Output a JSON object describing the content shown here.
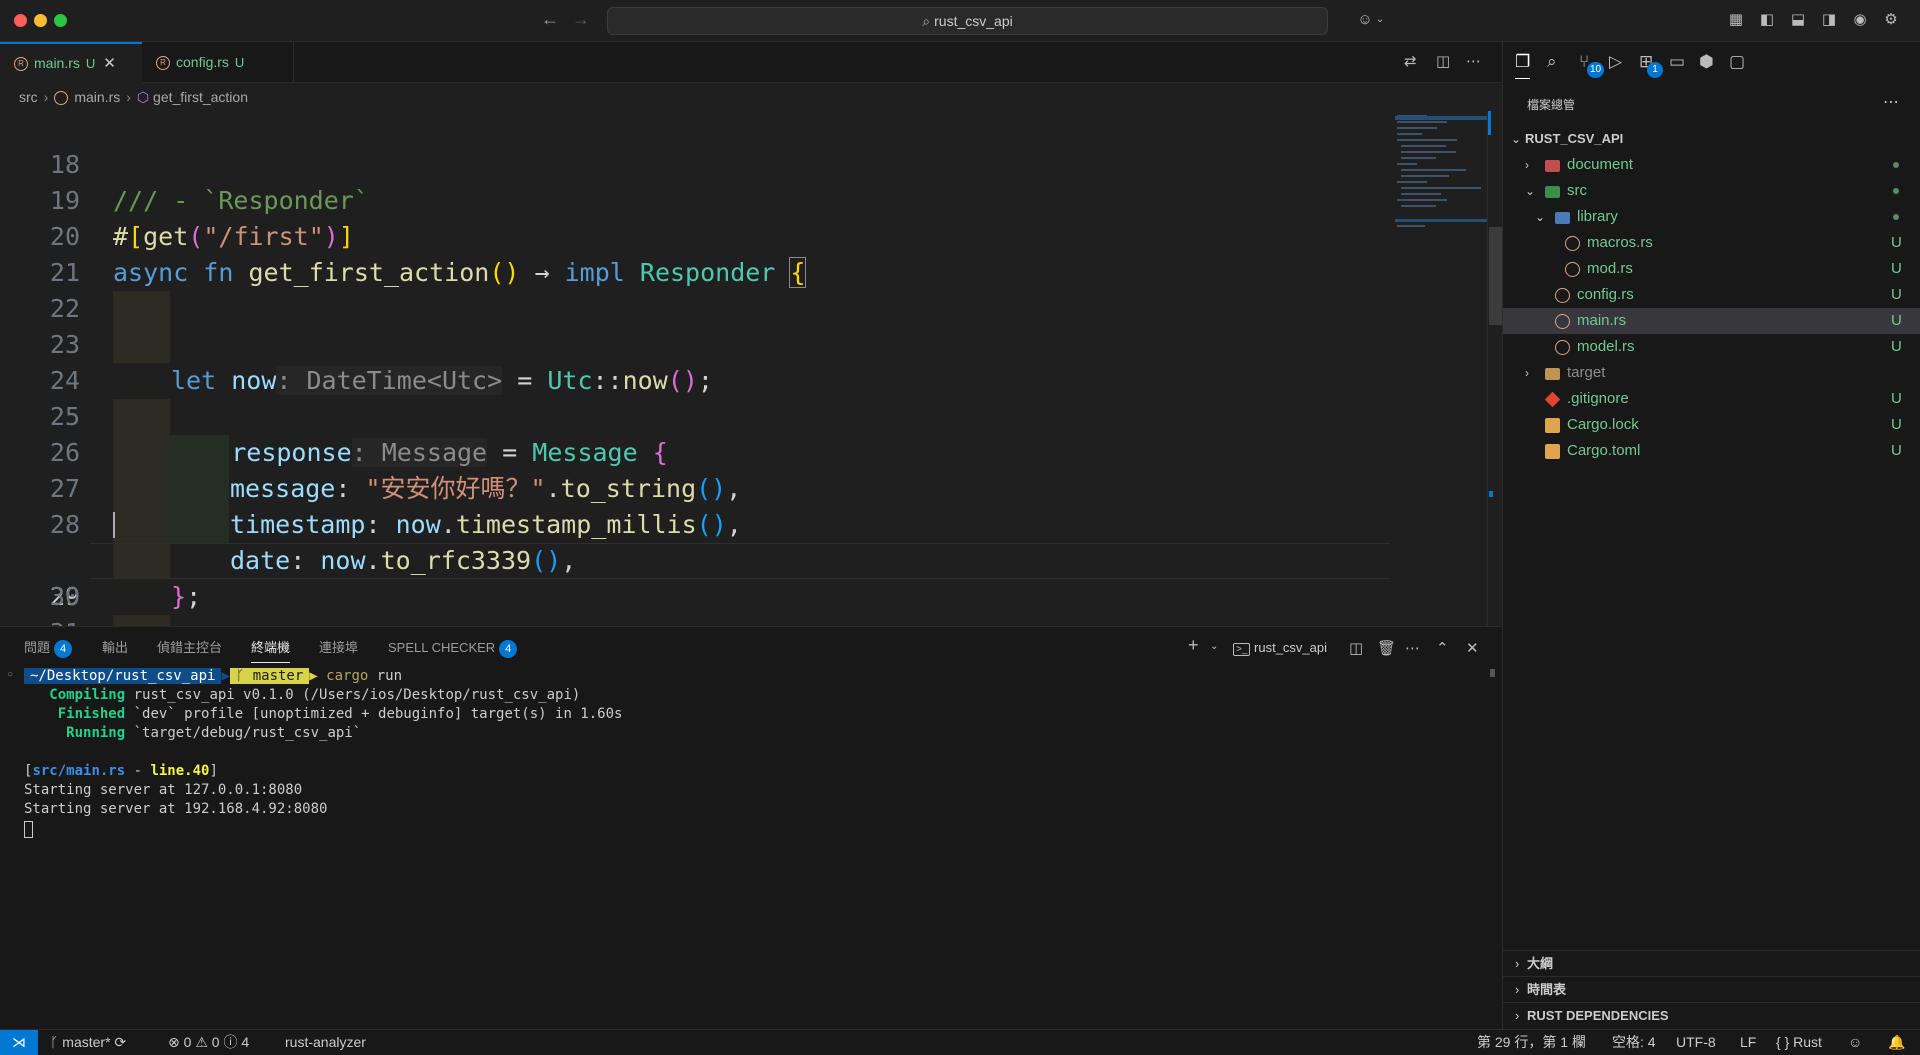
{
  "titlebar": {
    "search_text": "rust_csv_api"
  },
  "tabs": [
    {
      "label": "main.rs",
      "status": "U"
    },
    {
      "label": "config.rs",
      "status": "U"
    }
  ],
  "breadcrumb": {
    "folder": "src",
    "file": "main.rs",
    "symbol": "get_first_action"
  },
  "editor": {
    "line_numbers": [
      "18",
      "19",
      "20",
      "21",
      "22",
      "23",
      "24",
      "25",
      "26",
      "27",
      "28",
      "29",
      "30",
      "31"
    ],
    "current_line": "29"
  },
  "panel": {
    "tabs": {
      "problems": "問題",
      "problems_count": "4",
      "output": "輸出",
      "debug_console": "偵錯主控台",
      "terminal": "終端機",
      "ports": "連接埠",
      "spell_checker": "SPELL CHECKER",
      "spell_count": "4"
    },
    "terminal_name": "rust_csv_api",
    "terminal_lines": {
      "prompt_path": "~/Desktop/rust_csv_api",
      "prompt_branch": "master",
      "cmd_name": "cargo",
      "cmd_args": " run",
      "compiling_label": "Compiling",
      "compiling_text": " rust_csv_api v0.1.0 (/Users/ios/Desktop/rust_csv_api)",
      "finished_label": "Finished",
      "finished_text": " `dev` profile [unoptimized + debuginfo] target(s) in 1.60s",
      "running_label": "Running",
      "running_text": " `target/debug/rust_csv_api`",
      "log_file": "src/main.rs",
      "log_sep": " - ",
      "log_line": "line.40",
      "server1": "Starting server at 127.0.0.1:8080",
      "server2": "Starting server at 192.168.4.92:8080"
    }
  },
  "sidebar": {
    "title": "檔案總管",
    "scm_badge": "10",
    "ext_badge": "1",
    "project": "RUST_CSV_API",
    "tree": [
      {
        "name": "document",
        "status": ""
      },
      {
        "name": "src",
        "status": ""
      },
      {
        "name": "library",
        "status": ""
      },
      {
        "name": "macros.rs",
        "status": "U"
      },
      {
        "name": "mod.rs",
        "status": "U"
      },
      {
        "name": "config.rs",
        "status": "U"
      },
      {
        "name": "main.rs",
        "status": "U"
      },
      {
        "name": "model.rs",
        "status": "U"
      },
      {
        "name": "target",
        "status": ""
      },
      {
        "name": ".gitignore",
        "status": "U"
      },
      {
        "name": "Cargo.lock",
        "status": "U"
      },
      {
        "name": "Cargo.toml",
        "status": "U"
      }
    ],
    "sections": {
      "outline": "大綱",
      "timeline": "時間表",
      "deps": "RUST DEPENDENCIES"
    }
  },
  "statusbar": {
    "branch": "master*",
    "errors": "0",
    "warnings": "0",
    "infos": "4",
    "analyzer": "rust-analyzer",
    "position": "第 29 行，第 1 欄",
    "spaces": "空格: 4",
    "encoding": "UTF-8",
    "eol": "LF",
    "language": "Rust"
  },
  "colors": {
    "accent": "#0078d4",
    "modified": "#73c991"
  }
}
